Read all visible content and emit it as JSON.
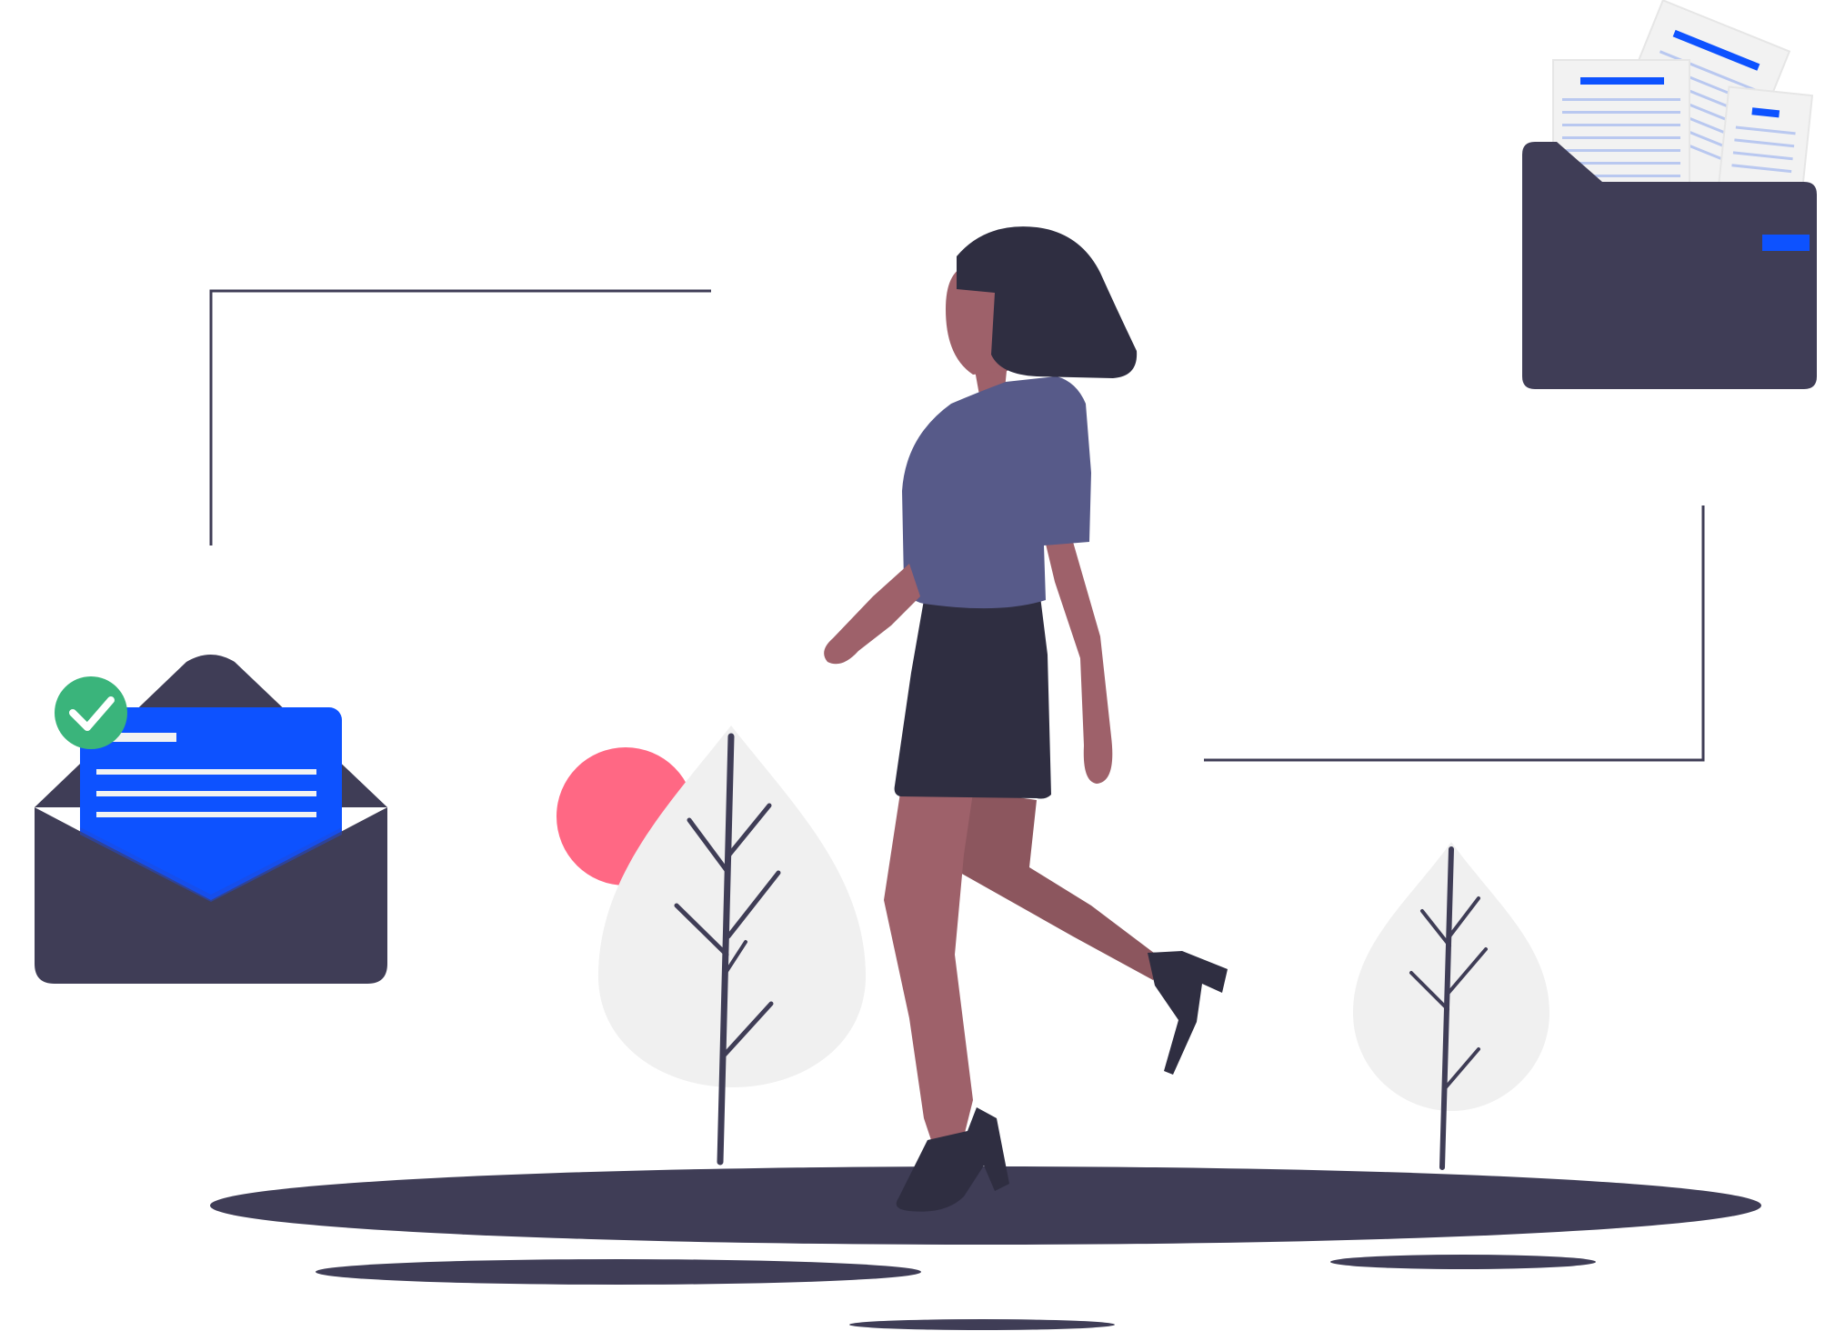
{
  "illustration": {
    "scene": "woman-walking-between-email-and-folder",
    "elements": {
      "email": {
        "icon": "open-envelope-icon",
        "status_icon": "check-circle-icon",
        "status": "verified"
      },
      "folder": {
        "icon": "folder-with-documents-icon",
        "document_count": 3
      },
      "person": {
        "icon": "walking-woman"
      },
      "trees": {
        "count": 2
      },
      "sun": {
        "icon": "sun-icon"
      }
    }
  },
  "colors": {
    "dark": "#3f3d56",
    "ink": "#2f2e41",
    "shirt": "#575a89",
    "skin": "#9e616a",
    "skin_shadow": "#8c565e",
    "accent_blue": "#0d52ff",
    "check_green": "#3ab47b",
    "sun_pink": "#ff6884",
    "tree_leaf": "#f0f0f0",
    "paper": "#f2f2f2",
    "paper_line": "#b9c8f0"
  }
}
